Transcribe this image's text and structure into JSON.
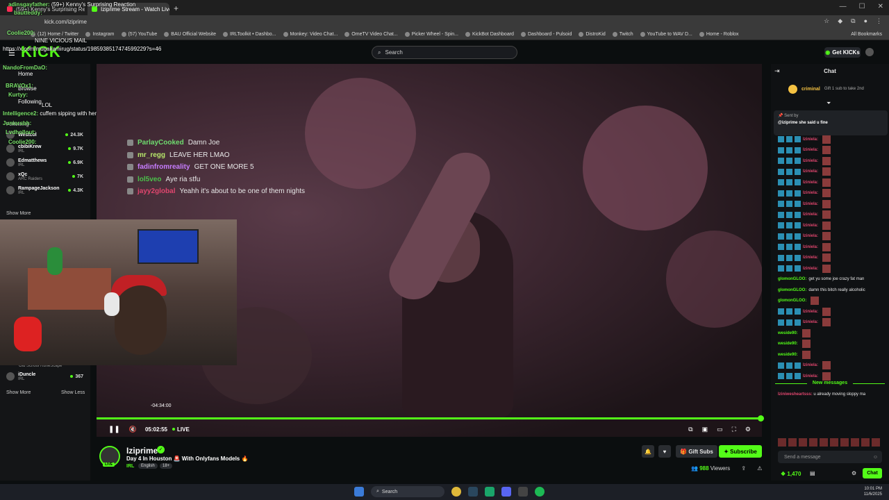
{
  "browser": {
    "tabs": [
      {
        "title": "(59+) Kenny's Surprising Reaction"
      },
      {
        "title": "Iziprime Stream - Watch Live o"
      }
    ],
    "url": "kick.com/iziprime",
    "bookmarks": [
      "(12) Home / Twitter",
      "Instagram",
      "(57) YouTube",
      "BAU Official Website",
      "IRLToolkit • Dashbo...",
      "Monkey: Video Chat...",
      "OmeTV Video Chat...",
      "Picker Wheel - Spin...",
      "KickBot Dashboard",
      "Dashboard - Pulsoid",
      "DistroKid",
      "Twitch",
      "YouTube to WAV D...",
      "Home - Roblox"
    ],
    "all_bookmarks": "All Bookmarks"
  },
  "kick": {
    "logo": "KICK",
    "search_placeholder": "Search",
    "get_kicks": "Get KICKs"
  },
  "overlay_top_chat": [
    {
      "user": "adinsgayfather:",
      "text": "(59+) Kenny's Surprising Reaction"
    },
    {
      "user": "bautteddy:",
      "text": ""
    },
    {
      "user": "Coolie200:",
      "text": ""
    },
    {
      "user": "",
      "text": "https://x.com/mugakamirug/status/1985938517474599229?s=46"
    },
    {
      "user": "",
      "text": "NINE VICIOUS MAIL"
    },
    {
      "user": "NandoFromDaO:",
      "text": ""
    },
    {
      "user": "BRAVOx1:",
      "text": ""
    },
    {
      "user": "Kurtyy:",
      "text": ""
    },
    {
      "user": "",
      "text": "LOL"
    },
    {
      "user": "Intelligence2:",
      "text": "cuffem sipping with her"
    },
    {
      "user": "Juniorsbh:",
      "text": ""
    },
    {
      "user": "Lvdhollout:",
      "text": ""
    },
    {
      "user": "Coolie200:",
      "text": ""
    }
  ],
  "sidebar": {
    "nav": [
      "Home",
      "Browse",
      "Following"
    ],
    "following_label": "Following",
    "channels": [
      {
        "name": "Westcol",
        "sub": "",
        "viewers": "24.3K"
      },
      {
        "name": "cbibiKrew",
        "sub": "IRL",
        "viewers": "9.7K"
      },
      {
        "name": "Edmatthews",
        "sub": "IRL",
        "viewers": "6.9K"
      },
      {
        "name": "xQc",
        "sub": "ARC Raiders",
        "viewers": "7K"
      },
      {
        "name": "RampageJackson",
        "sub": "IRL",
        "viewers": "4.3K"
      }
    ],
    "show_more": "Show More",
    "lower_channel": {
      "name": "iDuncle",
      "sub": "IRL",
      "viewers": "367"
    },
    "lower_sub_above": "Old School RuneScape",
    "show_more_2": "Show More",
    "show_less": "Show Less"
  },
  "video_chat_overlay": [
    {
      "user": "ParlayCooked",
      "text": "Damn Joe",
      "color": "#6fdc6f"
    },
    {
      "user": "mr_regg",
      "text": "LEAVE HER LMAO",
      "color": "#b7e86b"
    },
    {
      "user": "fadinfromreality",
      "text": "GET ONE MORE 5",
      "color": "#c77dff"
    },
    {
      "user": "lol5veo",
      "text": "Aye ria stfu",
      "color": "#4ac14a"
    },
    {
      "user": "jayy2global",
      "text": "Yeahh it's about to be one of them nights",
      "color": "#e0466e"
    }
  ],
  "player": {
    "progress_fraction": 1.0,
    "hover_time": "-04:34:00",
    "time": "05:02:55",
    "live": "LIVE"
  },
  "stream": {
    "streamer": "Iziprime",
    "title": "Day 4 In Houston 🚨 With Onlyfans Models 🔥",
    "category": "IRL",
    "tags": [
      "English",
      "18+"
    ],
    "live_badge": "LIVE",
    "gift_subs": "Gift Subs",
    "subscribe": "Subscribe",
    "viewers_count": "988",
    "viewers_label": "Viewers"
  },
  "chat": {
    "title": "Chat",
    "pinned_user": "criminal",
    "pinned_note": "Gift 1 sub to take 2nd",
    "pinned_sent_by": "Sent by",
    "pinned_message": "@iziprime she said u fine",
    "messages": [
      {
        "user": "Iziniela:",
        "color": "#e0466e",
        "text": "",
        "emote": true
      },
      {
        "user": "Iziniela:",
        "color": "#e0466e",
        "text": "",
        "emote": true
      },
      {
        "user": "Iziniela:",
        "color": "#e0466e",
        "text": "",
        "emote": true
      },
      {
        "user": "Iziniela:",
        "color": "#e0466e",
        "text": "",
        "emote": true
      },
      {
        "user": "Iziniela:",
        "color": "#e0466e",
        "text": "",
        "emote": true
      },
      {
        "user": "Iziniela:",
        "color": "#e0466e",
        "text": "",
        "emote": true
      },
      {
        "user": "Iziniela:",
        "color": "#e0466e",
        "text": "",
        "emote": true
      },
      {
        "user": "Iziniela:",
        "color": "#e0466e",
        "text": "",
        "emote": true
      },
      {
        "user": "Iziniela:",
        "color": "#e0466e",
        "text": "",
        "emote": true
      },
      {
        "user": "Iziniela:",
        "color": "#e0466e",
        "text": "",
        "emote": true
      },
      {
        "user": "Iziniela:",
        "color": "#e0466e",
        "text": "",
        "emote": true
      },
      {
        "user": "Iziniela:",
        "color": "#e0466e",
        "text": "",
        "emote": true
      },
      {
        "user": "Iziniela:",
        "color": "#e0466e",
        "text": "",
        "emote": true
      },
      {
        "user": "glomonGLOO:",
        "color": "#53fc18",
        "text": "get yu some joe crazy fat man",
        "emote": false
      },
      {
        "user": "glomonGLOO:",
        "color": "#53fc18",
        "text": "damn this bitch really alcoholic",
        "emote": false
      },
      {
        "user": "glomonGLOO:",
        "color": "#53fc18",
        "text": "",
        "emote": true
      },
      {
        "user": "Iziniela:",
        "color": "#e0466e",
        "text": "",
        "emote": true
      },
      {
        "user": "Iziniela:",
        "color": "#e0466e",
        "text": "",
        "emote": true
      },
      {
        "user": "weside90:",
        "color": "#53fc18",
        "text": "",
        "emote": true
      },
      {
        "user": "weside90:",
        "color": "#53fc18",
        "text": "",
        "emote": true
      },
      {
        "user": "weside90:",
        "color": "#53fc18",
        "text": "",
        "emote": true
      },
      {
        "user": "Iziniela:",
        "color": "#e0466e",
        "text": "",
        "emote": true
      },
      {
        "user": "Iziniela:",
        "color": "#e0466e",
        "text": "",
        "emote": true
      }
    ],
    "new_messages": "New messages",
    "after_new": {
      "user": "Iziniwesheartsss:",
      "text": "u already moving sloppy ma"
    },
    "send_placeholder": "Send a message",
    "kicks_balance": "1,470",
    "chat_button": "Chat"
  },
  "taskbar": {
    "search": "Search",
    "time": "10:01 PM",
    "date": "11/6/2025"
  },
  "colors": {
    "accent": "#53fc18"
  }
}
